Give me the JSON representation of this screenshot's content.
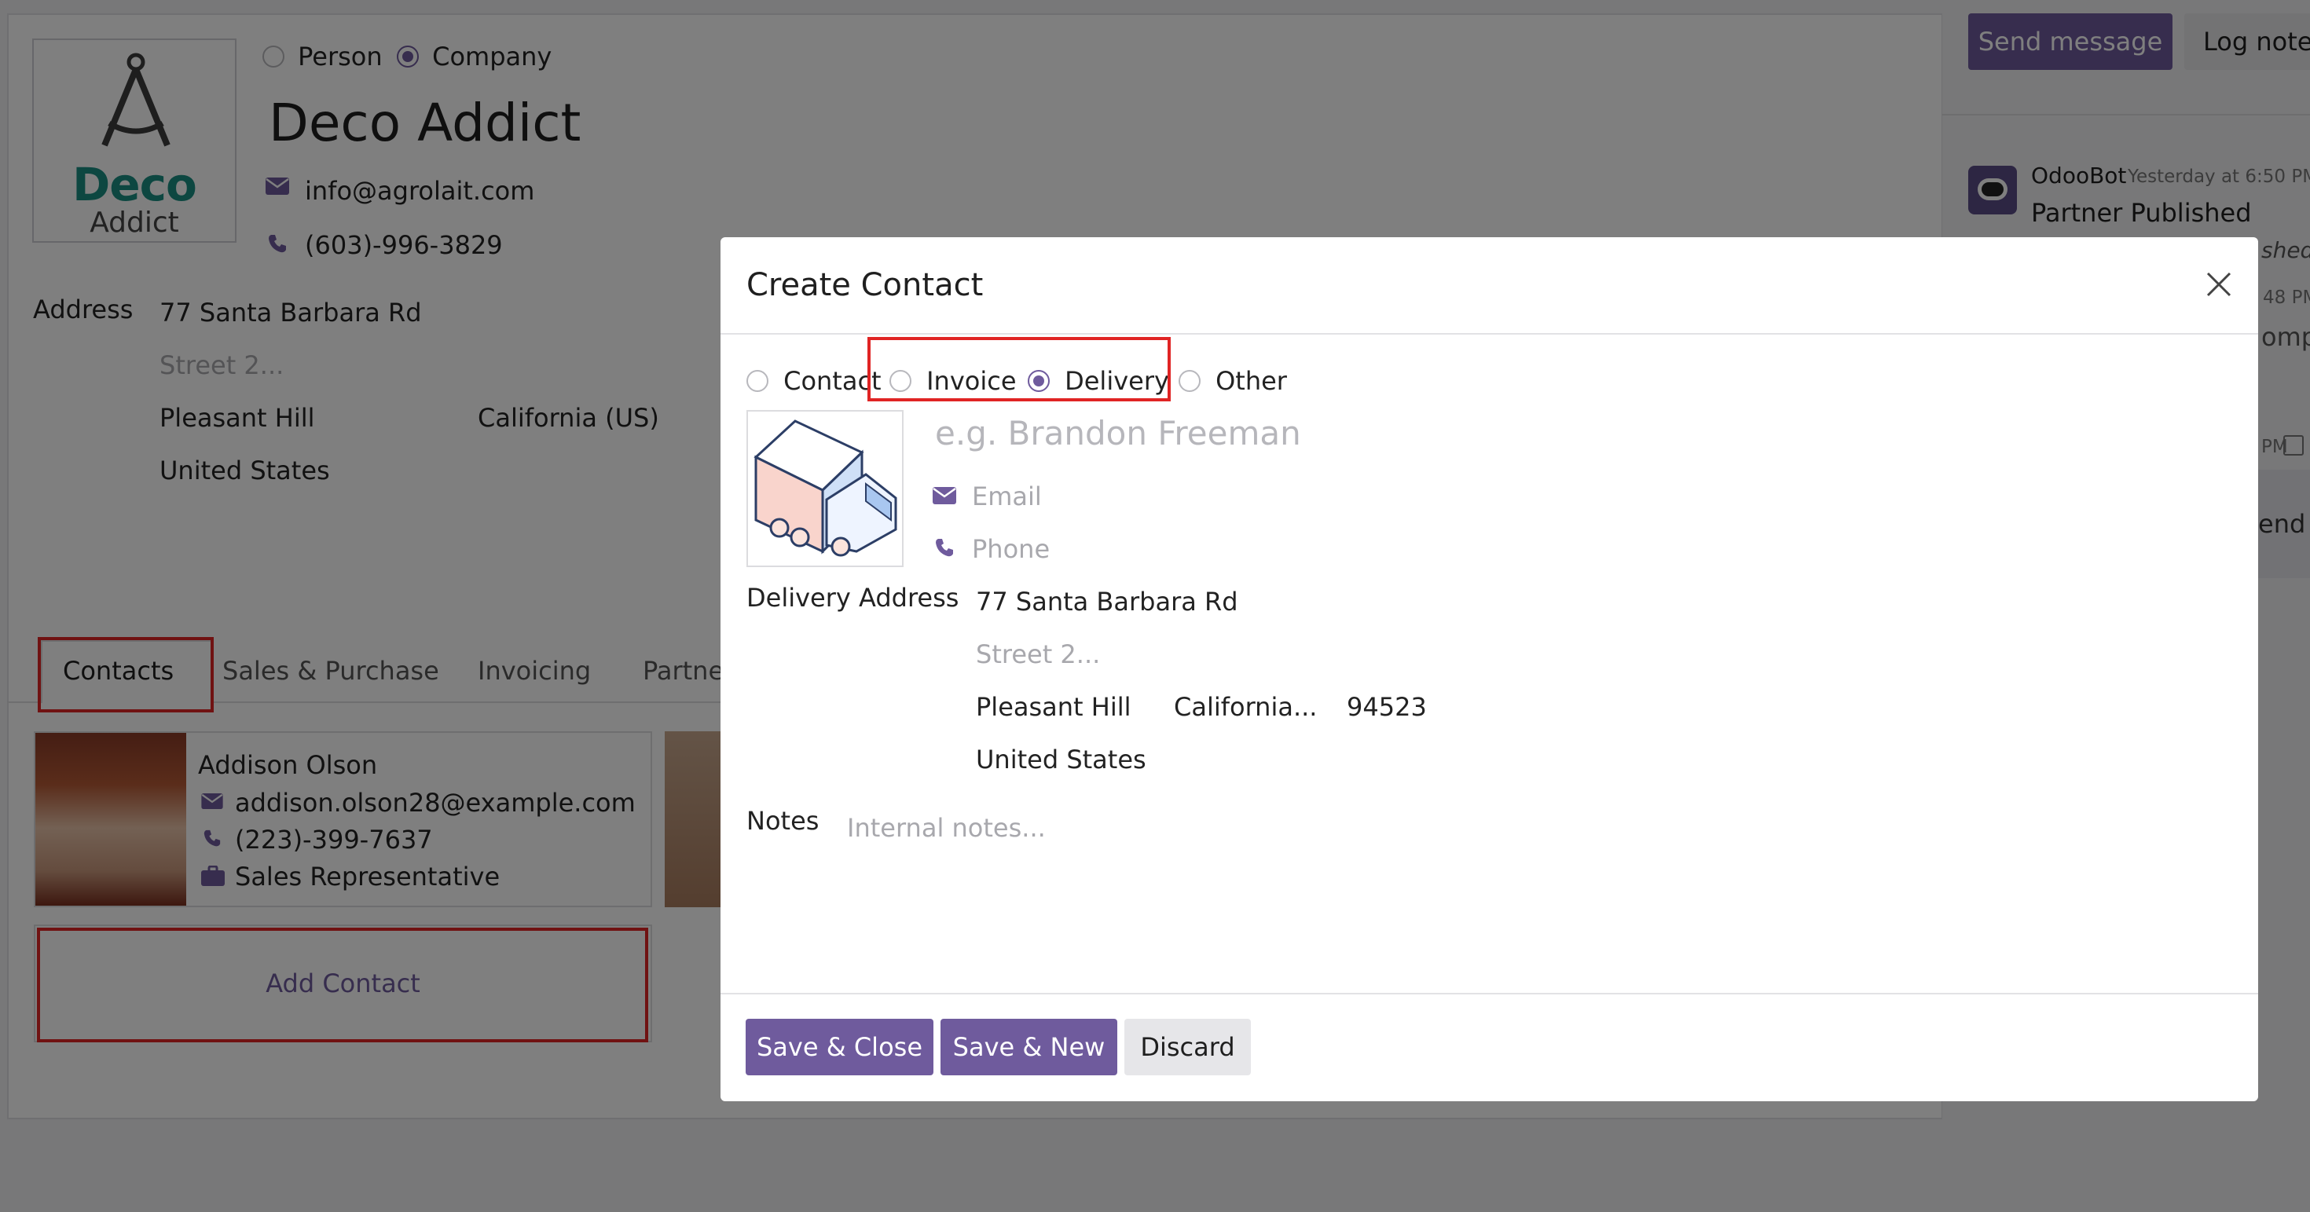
{
  "form": {
    "company_type_options": [
      {
        "label": "Person",
        "selected": false
      },
      {
        "label": "Company",
        "selected": true
      }
    ],
    "logo": {
      "line1": "Deco",
      "line2": "Addict"
    },
    "name": "Deco Addict",
    "email": "info@agrolait.com",
    "phone": "(603)-996-3829",
    "address_label": "Address",
    "street": "77 Santa Barbara Rd",
    "street2_placeholder": "Street 2...",
    "city": "Pleasant Hill",
    "state": "California (US)",
    "country": "United States",
    "tabs": [
      "Contacts",
      "Sales & Purchase",
      "Invoicing",
      "Partne"
    ],
    "contact_card": {
      "name": "Addison Olson",
      "email": "addison.olson28@example.com",
      "phone": "(223)-399-7637",
      "function": "Sales Representative"
    },
    "add_contact_label": "Add Contact"
  },
  "chatter": {
    "send_message": "Send message",
    "log_note": "Log note",
    "author": "OdooBot",
    "timestamp": "Yesterday at 6:50 PM",
    "message": "Partner Published",
    "partial_1": "shed,",
    "partial_2": "48 PM",
    "partial_3": "omp",
    "partial_4": "PM",
    "partial_5": "end"
  },
  "dialog": {
    "title": "Create Contact",
    "type_options": [
      {
        "label": "Contact",
        "selected": false
      },
      {
        "label": "Invoice",
        "selected": false
      },
      {
        "label": "Delivery",
        "selected": true
      },
      {
        "label": "Other",
        "selected": false
      }
    ],
    "name_placeholder": "e.g. Brandon Freeman",
    "email_placeholder": "Email",
    "phone_placeholder": "Phone",
    "address_label": "Delivery Address",
    "street": "77 Santa Barbara Rd",
    "street2_placeholder": "Street 2...",
    "city": "Pleasant Hill",
    "state": "California...",
    "zip": "94523",
    "country": "United States",
    "notes_label": "Notes",
    "notes_placeholder": "Internal notes...",
    "buttons": {
      "save_close": "Save & Close",
      "save_new": "Save & New",
      "discard": "Discard"
    }
  },
  "colors": {
    "primary": "#6f5b9d",
    "highlight": "#e02424",
    "logo_teal": "#1a8f82"
  }
}
